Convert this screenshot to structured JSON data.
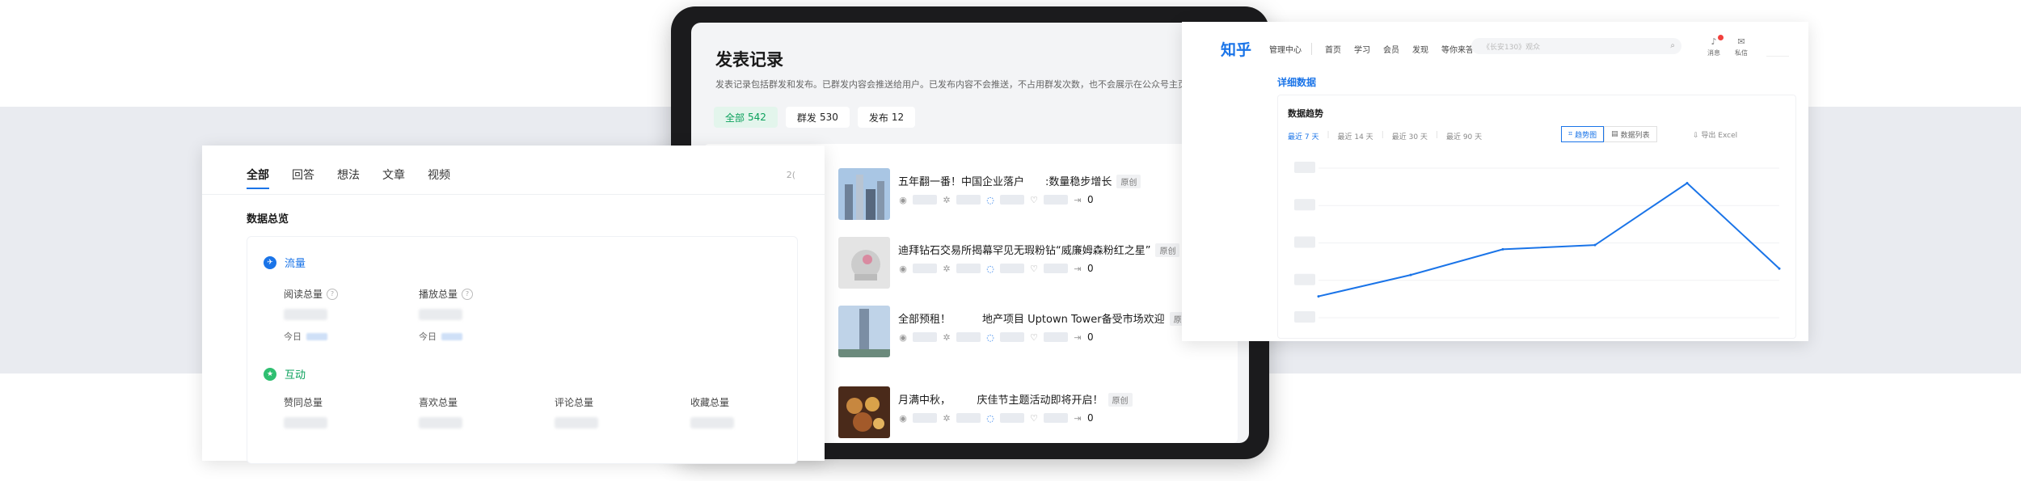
{
  "publish": {
    "title": "发表记录",
    "description": "发表记录包括群发和发布。已群发内容会推送给用户。已发布内容不会推送，不占用群发次数，也不会展示在公众号主页中",
    "tabs": [
      {
        "label": "全部",
        "count": "542"
      },
      {
        "label": "群发",
        "count": "530"
      },
      {
        "label": "发布",
        "count": "12"
      }
    ],
    "items": [
      {
        "title": "五年翻一番！中国企业落户　　:数量稳步增长",
        "badge": "原创",
        "shares": "0"
      },
      {
        "title": "迪拜钻石交易所揭幕罕见无瑕粉钻“威廉姆森粉红之星”",
        "badge": "原创",
        "shares": "0"
      },
      {
        "title": "全部预租！　　　地产项目 Uptown Tower备受市场欢迎",
        "badge": "原创",
        "shares": "0"
      },
      {
        "title": "月满中秋，　　　庆佳节主题活动即将开启！",
        "badge": "原创",
        "shares": "0"
      }
    ]
  },
  "analytics": {
    "tabs": [
      "全部",
      "回答",
      "想法",
      "文章",
      "视频"
    ],
    "more": "2(",
    "overview": "数据总览",
    "flow_section": "流量",
    "flow_metrics": [
      {
        "label": "阅读总量",
        "today": "今日"
      },
      {
        "label": "播放总量",
        "today": "今日"
      }
    ],
    "interact_section": "互动",
    "interact_metrics": [
      {
        "label": "赞同总量"
      },
      {
        "label": "喜欢总量"
      },
      {
        "label": "评论总量"
      },
      {
        "label": "收藏总量"
      }
    ]
  },
  "zhihu": {
    "logo": "知乎",
    "nav": [
      "管理中心",
      "首页",
      "学习",
      "会员",
      "发现",
      "等你来答"
    ],
    "search_placeholder": "《长安130》观众",
    "icons": [
      {
        "name": "消息"
      },
      {
        "name": "私信"
      }
    ],
    "detail_title": "详细数据",
    "trend_title": "数据趋势",
    "ranges": [
      "最近 7 天",
      "最近 14 天",
      "最近 30 天",
      "最近 90 天"
    ],
    "views": [
      "趋势图",
      "数据列表"
    ],
    "export": "导出 Excel"
  },
  "chart_data": {
    "type": "line",
    "title": "数据趋势",
    "x": [
      1,
      2,
      3,
      4,
      5,
      6
    ],
    "values": [
      1.0,
      2.0,
      3.2,
      3.4,
      6.3,
      2.3
    ],
    "ylim": [
      0,
      7
    ],
    "grid": true,
    "color": "#1a74e8"
  }
}
